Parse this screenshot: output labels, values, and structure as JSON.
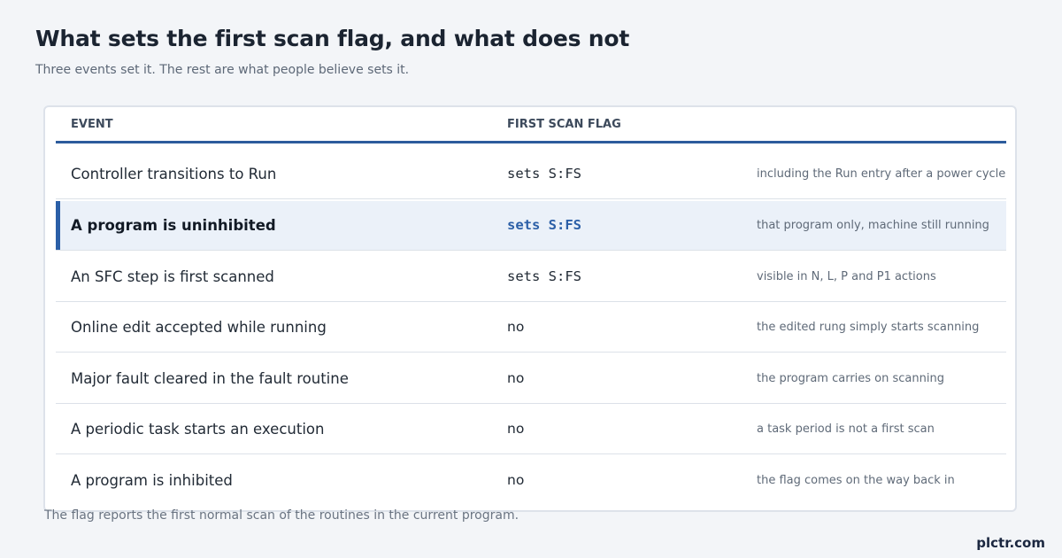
{
  "header": {
    "title": "What sets the first scan flag, and what does not",
    "subtitle": "Three events set it. The rest are what people believe sets it."
  },
  "table": {
    "columns": [
      "EVENT",
      "FIRST SCAN FLAG"
    ],
    "rows": [
      {
        "event": "Controller transitions to Run",
        "flag": "sets S:FS",
        "note": "including the Run entry after a power cycle",
        "highlighted": false
      },
      {
        "event": "A program is uninhibited",
        "flag": "sets S:FS",
        "note": "that program only, machine still running",
        "highlighted": true
      },
      {
        "event": "An SFC step is first scanned",
        "flag": "sets S:FS",
        "note": "visible in N, L, P and P1 actions",
        "highlighted": false
      },
      {
        "event": "Online edit accepted while running",
        "flag": "no",
        "note": "the edited rung simply starts scanning",
        "highlighted": false
      },
      {
        "event": "Major fault cleared in the fault routine",
        "flag": "no",
        "note": "the program carries on scanning",
        "highlighted": false
      },
      {
        "event": "A periodic task starts an execution",
        "flag": "no",
        "note": "a task period is not a first scan",
        "highlighted": false
      },
      {
        "event": "A program is inhibited",
        "flag": "no",
        "note": "the flag comes on the way back in",
        "highlighted": false
      }
    ]
  },
  "footnote": "The flag reports the first normal scan of the routines in the current program.",
  "brand": "plctr.com",
  "colors": {
    "accent": "#2b5fa7",
    "highlight_bg": "#ebf1f9",
    "background": "#f3f5f8"
  }
}
